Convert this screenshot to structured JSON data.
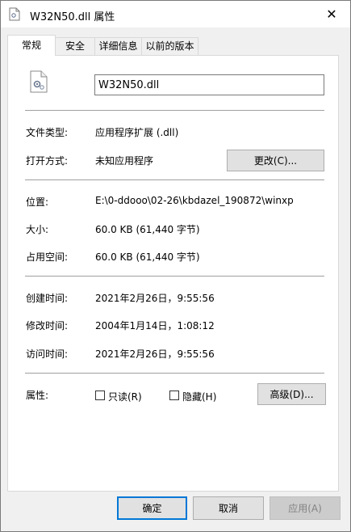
{
  "window": {
    "title": "W32N50.dll 属性",
    "close_glyph": "✕"
  },
  "tabs": [
    {
      "label": "常规"
    },
    {
      "label": "安全"
    },
    {
      "label": "详细信息"
    },
    {
      "label": "以前的版本"
    }
  ],
  "general": {
    "file_name": "W32N50.dll",
    "file_type_label": "文件类型:",
    "file_type_value": "应用程序扩展 (.dll)",
    "opens_with_label": "打开方式:",
    "opens_with_value": "未知应用程序",
    "change_button": "更改(C)...",
    "location_label": "位置:",
    "location_value": "E:\\0-ddooo\\02-26\\kbdazel_190872\\winxp",
    "size_label": "大小:",
    "size_value": "60.0 KB (61,440 字节)",
    "size_on_disk_label": "占用空间:",
    "size_on_disk_value": "60.0 KB (61,440 字节)",
    "created_label": "创建时间:",
    "created_value": "2021年2月26日，9:55:56",
    "modified_label": "修改时间:",
    "modified_value": "2004年1月14日，1:08:12",
    "accessed_label": "访问时间:",
    "accessed_value": "2021年2月26日，9:55:56",
    "attributes_label": "属性:",
    "readonly_label": "只读(R)",
    "hidden_label": "隐藏(H)",
    "advanced_button": "高级(D)..."
  },
  "footer": {
    "ok_button": "确定",
    "cancel_button": "取消",
    "apply_button": "应用(A)"
  },
  "colors": {
    "accent": "#0078d7",
    "separator": "#a0a0a0"
  }
}
